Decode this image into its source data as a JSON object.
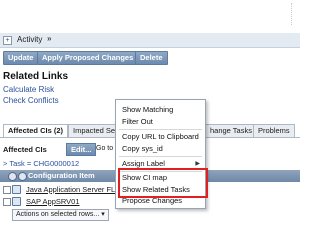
{
  "activity": {
    "label": "Activity",
    "chevron": "»"
  },
  "buttons": {
    "update": "Update",
    "apply": "Apply Proposed Changes",
    "delete": "Delete"
  },
  "related_links": {
    "title": "Related Links",
    "items": [
      "Calculate Risk",
      "Check Conflicts"
    ]
  },
  "tabs": [
    {
      "label": "Affected CIs (2)",
      "active": true
    },
    {
      "label": "Impacted Se"
    },
    {
      "label": "hange Tasks"
    },
    {
      "label": "Problems"
    }
  ],
  "list": {
    "title": "Affected CIs",
    "edit_label": "Edit...",
    "goto_label": "Go to",
    "task_prefix": "Task =",
    "task_value": "CHG0000012",
    "column_header": "Configuration Item",
    "rows": [
      "Java Application Server FL",
      "SAP AppSRV01"
    ],
    "actions_label": "Actions on selected rows..."
  },
  "context_menu": {
    "items": {
      "show_matching": "Show Matching",
      "filter_out": "Filter Out",
      "copy_url": "Copy URL to Clipboard",
      "copy_sysid": "Copy sys_id",
      "assign_label": "Assign Label",
      "show_ci_map": "Show CI map",
      "show_related_tasks": "Show Related Tasks",
      "propose_changes": "Propose Changes"
    },
    "submenu_arrow": "▶"
  },
  "colors": {
    "button": "#7a96b8",
    "link": "#2b4f9e",
    "grid_header": "#7d95b2",
    "highlight": "#e02020"
  }
}
